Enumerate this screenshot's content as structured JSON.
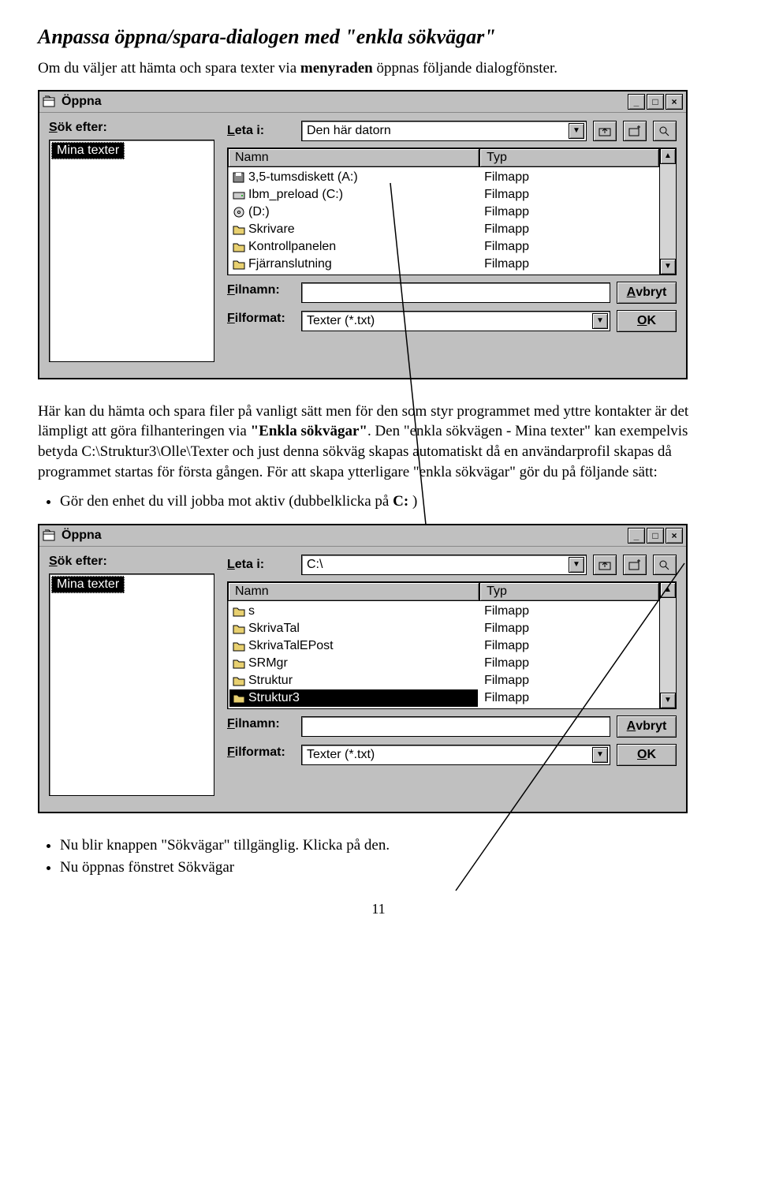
{
  "doc": {
    "heading": "Anpassa öppna/spara-dialogen med \"enkla sökvägar\"",
    "intro_a": "Om du väljer att hämta och spara texter via ",
    "intro_b": "menyraden",
    "intro_c": " öppnas följande dialogfönster.",
    "para2_a": "Här kan du hämta och spara filer på vanligt sätt men för den som styr programmet med yttre kontakter är det lämpligt att göra filhanteringen via ",
    "para2_b": "\"Enkla sökvägar\"",
    "para2_c": ". Den \"enkla sökvägen - Mina texter\" kan exempelvis betyda C:\\Struktur3\\Olle\\Texter och just denna sökväg skapas automatiskt då en användarprofil skapas då programmet startas för första gången. För att skapa ytterligare \"enkla sökvägar\" gör du på följande sätt:",
    "bullet1_a": "Gör den enhet du vill jobba mot aktiv (dubbelklicka på ",
    "bullet1_b": "C:",
    "bullet1_c": " )",
    "bullet2": "Nu blir knappen \"Sökvägar\" tillgänglig. Klicka på den.",
    "bullet3": "Nu öppnas fönstret Sökvägar",
    "page_num": "11"
  },
  "d1": {
    "title": "Öppna",
    "sok_label_u": "S",
    "sok_label": "ök efter:",
    "sel_item": "Mina texter",
    "leta_label_u": "L",
    "leta_label": "eta i:",
    "leta_value": "Den här datorn",
    "col_name": "Namn",
    "col_type": "Typ",
    "items": [
      {
        "name": "3,5-tumsdiskett (A:)",
        "type": "Filmapp",
        "icon": "floppy"
      },
      {
        "name": "Ibm_preload (C:)",
        "type": "Filmapp",
        "icon": "drive"
      },
      {
        "name": "(D:)",
        "type": "Filmapp",
        "icon": "cd"
      },
      {
        "name": "Skrivare",
        "type": "Filmapp",
        "icon": "folder"
      },
      {
        "name": "Kontrollpanelen",
        "type": "Filmapp",
        "icon": "folder"
      },
      {
        "name": "Fjärranslutning",
        "type": "Filmapp",
        "icon": "folder"
      }
    ],
    "filnamn_label_u": "F",
    "filnamn_label": "ilnamn:",
    "filformat_label_u": "F",
    "filformat_label": "ilformat:",
    "filformat_value": "Texter (*.txt)",
    "avbryt_u": "A",
    "avbryt": "vbryt",
    "ok_u": "O",
    "ok": "K"
  },
  "d2": {
    "title": "Öppna",
    "sok_label_u": "S",
    "sok_label": "ök efter:",
    "sel_item": "Mina texter",
    "leta_label_u": "L",
    "leta_label": "eta i:",
    "leta_value": "C:\\",
    "col_name": "Namn",
    "col_type": "Typ",
    "items": [
      {
        "name": "s",
        "type": "Filmapp"
      },
      {
        "name": "SkrivaTal",
        "type": "Filmapp"
      },
      {
        "name": "SkrivaTalEPost",
        "type": "Filmapp"
      },
      {
        "name": "SRMgr",
        "type": "Filmapp"
      },
      {
        "name": "Struktur",
        "type": "Filmapp"
      },
      {
        "name": "Struktur3",
        "type": "Filmapp",
        "sel": true
      }
    ],
    "filnamn_label_u": "F",
    "filnamn_label": "ilnamn:",
    "filformat_label_u": "F",
    "filformat_label": "ilformat:",
    "filformat_value": "Texter (*.txt)",
    "avbryt_u": "A",
    "avbryt": "vbryt",
    "ok_u": "O",
    "ok": "K"
  }
}
